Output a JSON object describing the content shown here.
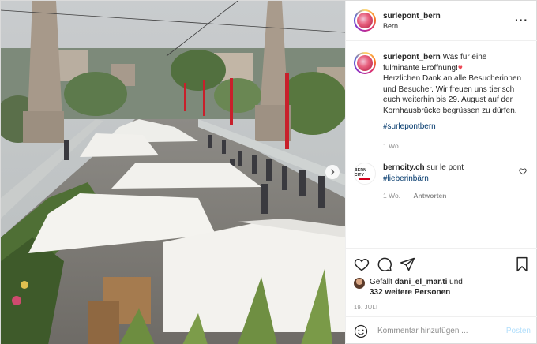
{
  "post": {
    "username": "surlepont_bern",
    "location": "Bern",
    "more_icon": "more-horizontal-icon",
    "photo": {
      "description_icon": "photo",
      "next_icon": "chevron-right-icon"
    }
  },
  "caption": {
    "username": "surlepont_bern",
    "text_1": "Was für eine fulminante Eröffnung!",
    "emoji": "♥",
    "text_2": "Herzlichen Dank an alle Besucherinnen und Besucher. Wir freuen uns tierisch euch weiterhin bis 29. August auf der Kornhausbrücke begrüssen zu dürfen.",
    "hashtag": "#surlepontbern",
    "time": "1 Wo."
  },
  "comment": {
    "avatar_text": "BERN CITY",
    "username": "berncity.ch",
    "text": "sur le pont",
    "hashtag": "#lieberinbärn",
    "time": "1 Wo.",
    "reply": "Antworten"
  },
  "actions": {
    "likes_prefix": "Gefällt",
    "likes_user": "dani_el_mar.ti",
    "likes_mid": "und",
    "likes_others": "332 weitere Personen",
    "date": "19. JULI"
  },
  "add_comment": {
    "placeholder": "Kommentar hinzufügen ...",
    "post_label": "Posten"
  },
  "colors": {
    "link": "#00376b",
    "muted": "#8e8e8e",
    "post_button": "#b2dffc",
    "heart": "#ed4956"
  }
}
